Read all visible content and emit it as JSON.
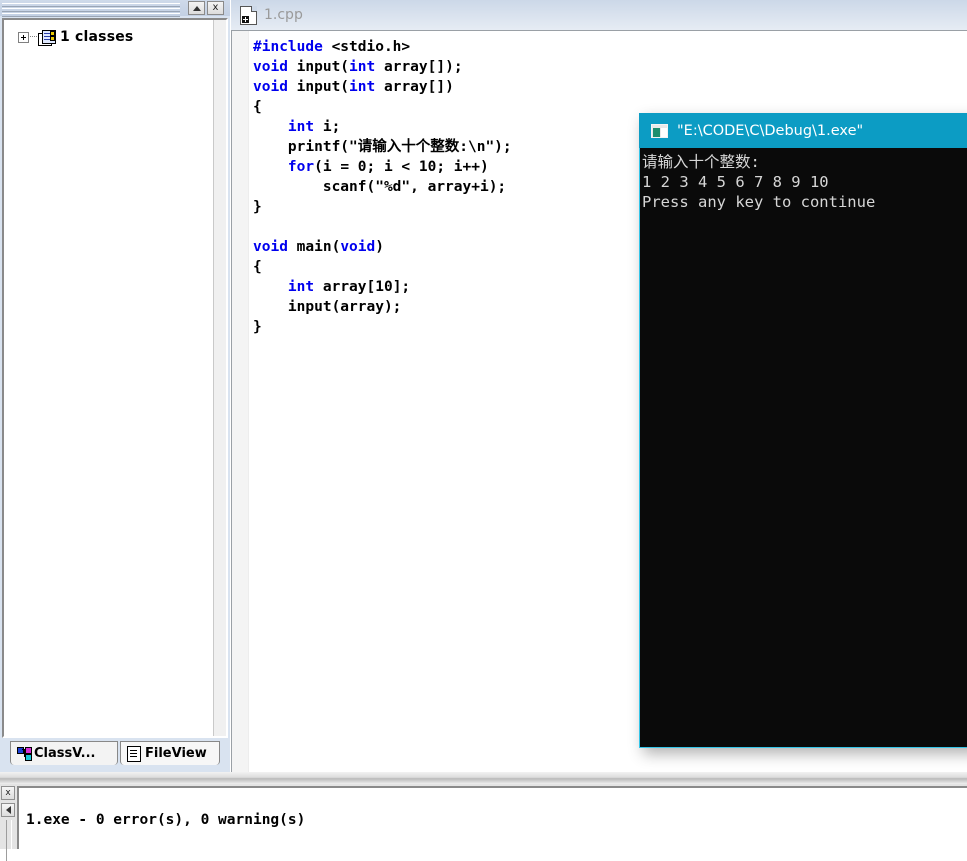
{
  "workspace": {
    "titlebar": {
      "minimize_label": "Minimize",
      "close_label": "x"
    },
    "tree": {
      "root_label": "1 classes",
      "expander_state": "+",
      "icon": "class-folder-icon"
    },
    "tabs": [
      {
        "label": "ClassV...",
        "icon": "classview-icon",
        "active": true
      },
      {
        "label": "FileView",
        "icon": "fileview-icon",
        "active": false
      }
    ]
  },
  "editor": {
    "tab_title": "1.cpp",
    "tab_icon": "cpp-file-icon",
    "code_lines": [
      [
        {
          "t": "#include ",
          "c": "kw"
        },
        {
          "t": "<stdio.h>",
          "c": ""
        }
      ],
      [
        {
          "t": "void ",
          "c": "kw"
        },
        {
          "t": "input(",
          "c": ""
        },
        {
          "t": "int",
          "c": "kw"
        },
        {
          "t": " array[]);",
          "c": ""
        }
      ],
      [
        {
          "t": "void ",
          "c": "kw"
        },
        {
          "t": "input(",
          "c": ""
        },
        {
          "t": "int",
          "c": "kw"
        },
        {
          "t": " array[])",
          "c": ""
        }
      ],
      [
        {
          "t": "{",
          "c": ""
        }
      ],
      [
        {
          "t": "    ",
          "c": ""
        },
        {
          "t": "int",
          "c": "kw"
        },
        {
          "t": " i;",
          "c": ""
        }
      ],
      [
        {
          "t": "    printf(\"请输入十个整数:\\n\");",
          "c": ""
        }
      ],
      [
        {
          "t": "    ",
          "c": ""
        },
        {
          "t": "for",
          "c": "kw"
        },
        {
          "t": "(i = 0; i < 10; i++)",
          "c": ""
        }
      ],
      [
        {
          "t": "        scanf(\"%d\", array+i);",
          "c": ""
        }
      ],
      [
        {
          "t": "}",
          "c": ""
        }
      ],
      [
        {
          "t": "",
          "c": ""
        }
      ],
      [
        {
          "t": "void ",
          "c": "kw"
        },
        {
          "t": "main(",
          "c": ""
        },
        {
          "t": "void",
          "c": "kw"
        },
        {
          "t": ")",
          "c": ""
        }
      ],
      [
        {
          "t": "{",
          "c": ""
        }
      ],
      [
        {
          "t": "    ",
          "c": ""
        },
        {
          "t": "int",
          "c": "kw"
        },
        {
          "t": " array[10];",
          "c": ""
        }
      ],
      [
        {
          "t": "    input(array);",
          "c": ""
        }
      ],
      [
        {
          "t": "}",
          "c": ""
        }
      ]
    ]
  },
  "console": {
    "title": "\"E:\\CODE\\C\\Debug\\1.exe\"",
    "icon": "console-window-icon",
    "output_lines": [
      "请输入十个整数:",
      "1 2 3 4 5 6 7 8 9 10",
      "Press any key to continue"
    ],
    "title_bg": "#0c9cc4",
    "body_bg": "#0a0a0a",
    "border_color": "#35c5e8"
  },
  "output_pane": {
    "close_label": "x",
    "scroll_left_label": "Scroll left",
    "build_result": "1.exe - 0 error(s), 0 warning(s)"
  },
  "colors": {
    "keyword": "#0000ee",
    "console_accent": "#0c9cc4",
    "editor_title_bg": "#ccd8e8"
  }
}
